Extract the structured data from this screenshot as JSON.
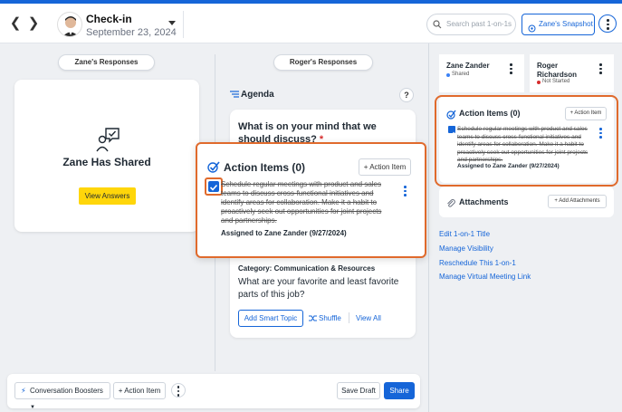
{
  "header": {
    "title": "Check-in",
    "date": "September 23, 2024",
    "search_placeholder": "Search past 1-on-1s",
    "snapshot_label": "Zane's Snapshot"
  },
  "left_column": {
    "pill": "Zane's Responses",
    "card_title": "Zane Has Shared",
    "view_answers": "View Answers"
  },
  "middle_column": {
    "pill": "Roger's Responses",
    "agenda_label": "Agenda",
    "help": "?",
    "question1": "What is on your mind that we should discuss?",
    "question1_required": "*",
    "category": "Category: Communication & Resources",
    "question2": "What are your favorite and least favorite parts of this job?",
    "add_smart_topic": "Add Smart Topic",
    "shuffle": "Shuffle",
    "view_all": "View All"
  },
  "bottom_bar": {
    "conversation_boosters": "Conversation Boosters",
    "action_item": "+ Action Item",
    "save_draft": "Save Draft",
    "share": "Share"
  },
  "right_panel": {
    "people": [
      {
        "name": "Zane Zander",
        "status": "Shared",
        "status_color": "#3b82f6"
      },
      {
        "name": "Roger Richardson",
        "status": "Not Started",
        "status_color": "#d62c2c"
      }
    ],
    "action_items": {
      "title": "Action Items (0)",
      "button": "+ Action Item",
      "item_text": "Schedule regular meetings with product and sales teams to discuss cross-functional initiatives and identify areas for collaboration. Make it a habit to proactively seek out opportunities for joint projects and partnerships.",
      "assigned": "Assigned to Zane Zander (9/27/2024)"
    },
    "attachments": {
      "title": "Attachments",
      "button": "+ Add Attachments"
    },
    "links": [
      "Edit 1-on-1 Title",
      "Manage Visibility",
      "Reschedule This 1-on-1",
      "Manage Virtual Meeting Link"
    ]
  },
  "overlay": {
    "title": "Action Items (0)",
    "button": "+ Action Item",
    "item_text": "Schedule regular meetings with product and sales teams to discuss cross-functional initiatives and identify areas for collaboration. Make it a habit to proactively seek out opportunities for joint projects and partnerships.",
    "assigned": "Assigned to Zane Zander (9/27/2024)"
  },
  "colors": {
    "accent": "#1565d8",
    "highlight": "#e06a2c",
    "yellow": "#ffd60a"
  }
}
